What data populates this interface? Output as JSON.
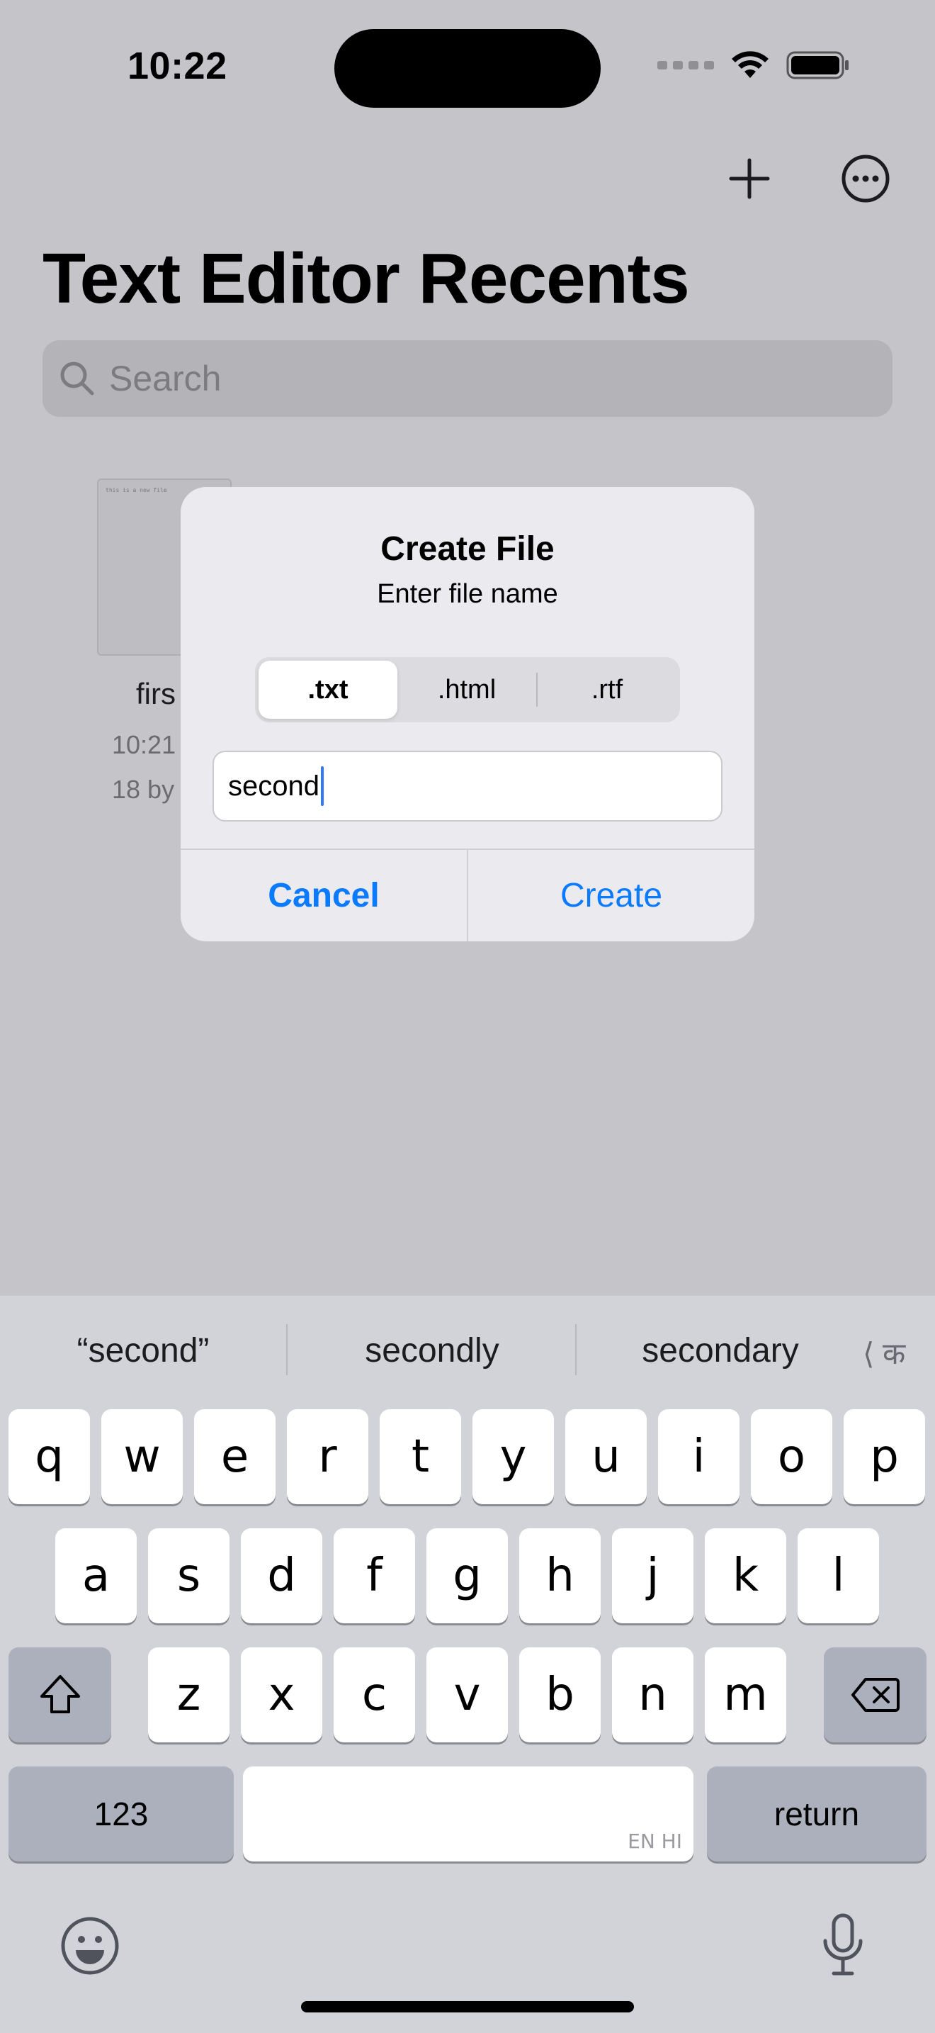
{
  "status_bar": {
    "time": "10:22"
  },
  "nav": {
    "add_icon": "plus-icon",
    "more_icon": "ellipsis-circle-icon"
  },
  "page": {
    "title": "Text Editor Recents"
  },
  "search": {
    "placeholder": "Search"
  },
  "recent_file": {
    "name": "firs",
    "time": "10:21",
    "size": "18 by",
    "preview_text": "this is a new file"
  },
  "dialog": {
    "title": "Create File",
    "message": "Enter file name",
    "segments": [
      ".txt",
      ".html",
      ".rtf"
    ],
    "selected_segment": ".txt",
    "field_value": "second",
    "cancel_label": "Cancel",
    "create_label": "Create"
  },
  "keyboard": {
    "suggestions": [
      "“second”",
      "secondly",
      "secondary"
    ],
    "lang_suggestion": "⟨ क",
    "row1": [
      "q",
      "w",
      "e",
      "r",
      "t",
      "y",
      "u",
      "i",
      "o",
      "p"
    ],
    "row2": [
      "a",
      "s",
      "d",
      "f",
      "g",
      "h",
      "j",
      "k",
      "l"
    ],
    "row3": [
      "z",
      "x",
      "c",
      "v",
      "b",
      "n",
      "m"
    ],
    "numbers_label": "123",
    "return_label": "return",
    "space_lang": "EN HI"
  },
  "colors": {
    "accent": "#0a7aff",
    "caret": "#3478f6",
    "dim_background": "#c4c4c9"
  }
}
